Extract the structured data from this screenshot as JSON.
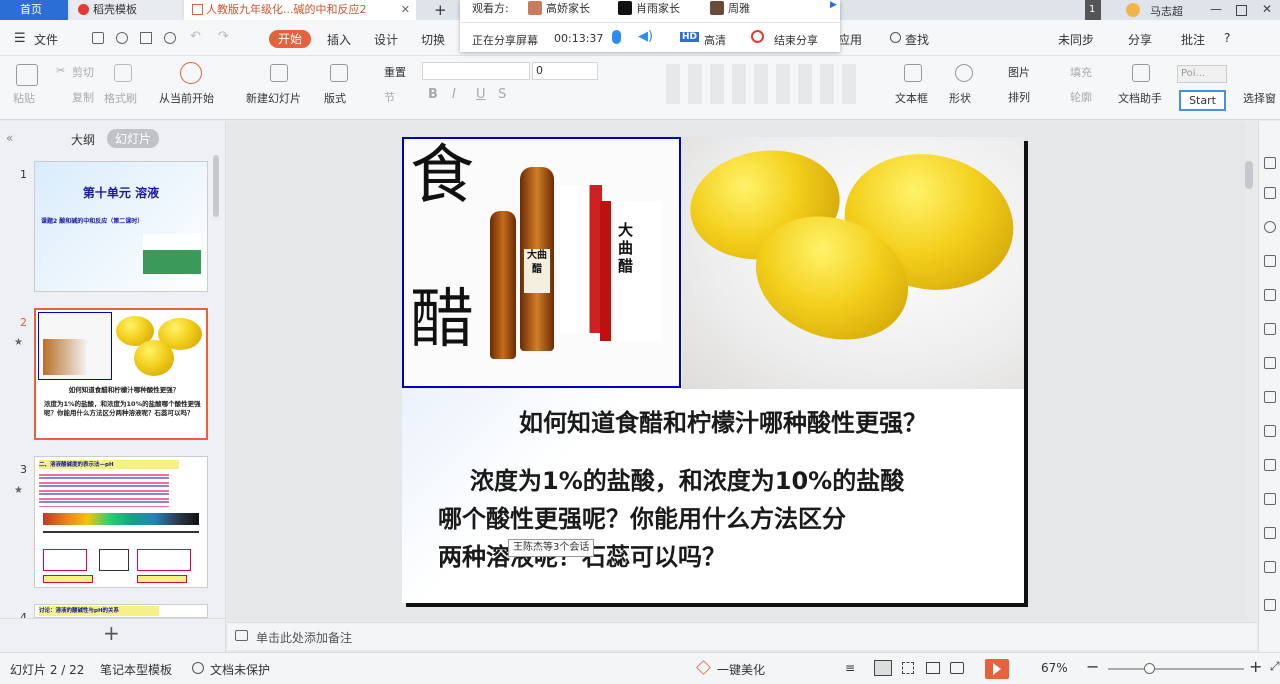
{
  "tabs": {
    "home": "首页",
    "template": "稻壳模板",
    "doc": "人教版九年级化...碱的中和反应2",
    "add": "+"
  },
  "user": {
    "name": "马志超",
    "badge": "1"
  },
  "share": {
    "viewers_label": "观看方:",
    "viewers": [
      "高娇家长",
      "肖雨家长",
      "周雅"
    ],
    "status": "正在分享屏幕",
    "time": "00:13:37",
    "hd": "高清",
    "end": "结束分享"
  },
  "ribbon_tabs": [
    "文件",
    "开始",
    "插入",
    "设计",
    "切换",
    "应用",
    "查找"
  ],
  "ribbon_right": {
    "sync": "未同步",
    "share": "分享",
    "comment": "批注",
    "help": "?"
  },
  "ribbon": {
    "paste": "粘贴",
    "cut": "剪切",
    "copy": "复制",
    "format_painter": "格式刷",
    "from_start": "从当前开始",
    "new_slide": "新建幻灯片",
    "layout": "版式",
    "reset": "重置",
    "section": "节",
    "font_size": "0",
    "textbox": "文本框",
    "shape": "形状",
    "picture": "图片",
    "arrange": "排列",
    "fill": "填充",
    "outline": "轮廓",
    "doc_helper": "文档助手",
    "select_pane": "选择窗",
    "popup_text": "Poi...",
    "start_btn": "Start"
  },
  "panel": {
    "outline_tab": "大纲",
    "slides_tab": "幻灯片",
    "add": "+"
  },
  "thumbs": [
    {
      "num": "1",
      "title": "第十单元 溶液",
      "subtitle": "课题2 酸和碱的中和反应（第二课时）"
    },
    {
      "num": "2",
      "line1": "如何知道食醋和柠檬汁哪种酸性更强？",
      "line2": "浓度为1%的盐酸，和浓度为10%的盐酸哪个酸性更强呢？你能用什么方法区分两种溶液呢？石蕊可以吗？"
    },
    {
      "num": "3",
      "line1": "二、溶液酸碱度的表示法—pH"
    },
    {
      "num": "4",
      "line1": "讨论：溶液的酸碱性与pH的关系"
    }
  ],
  "slide": {
    "glyph1": "食",
    "glyph2": "醋",
    "bottle_text": "大曲醋",
    "q1": "如何知道食醋和柠檬汁哪种酸性更强？",
    "q2a": "浓度为1%的盐酸，和浓度为10%的盐酸",
    "q2b": "哪个酸性更强呢？你能用什么方法区分",
    "q2c": "两种溶液呢？石蕊可以吗？",
    "tooltip": "王陈杰等3个会话"
  },
  "notes_placeholder": "单击此处添加备注",
  "status": {
    "slide_count": "幻灯片 2 / 22",
    "template": "笔记本型模板",
    "protect": "文档未保护",
    "beautify": "一键美化",
    "zoom": "67%"
  },
  "colors": {
    "accent": "#e8603c",
    "slide_border": "#0000c0",
    "title_blue": "#1f3ea8"
  }
}
